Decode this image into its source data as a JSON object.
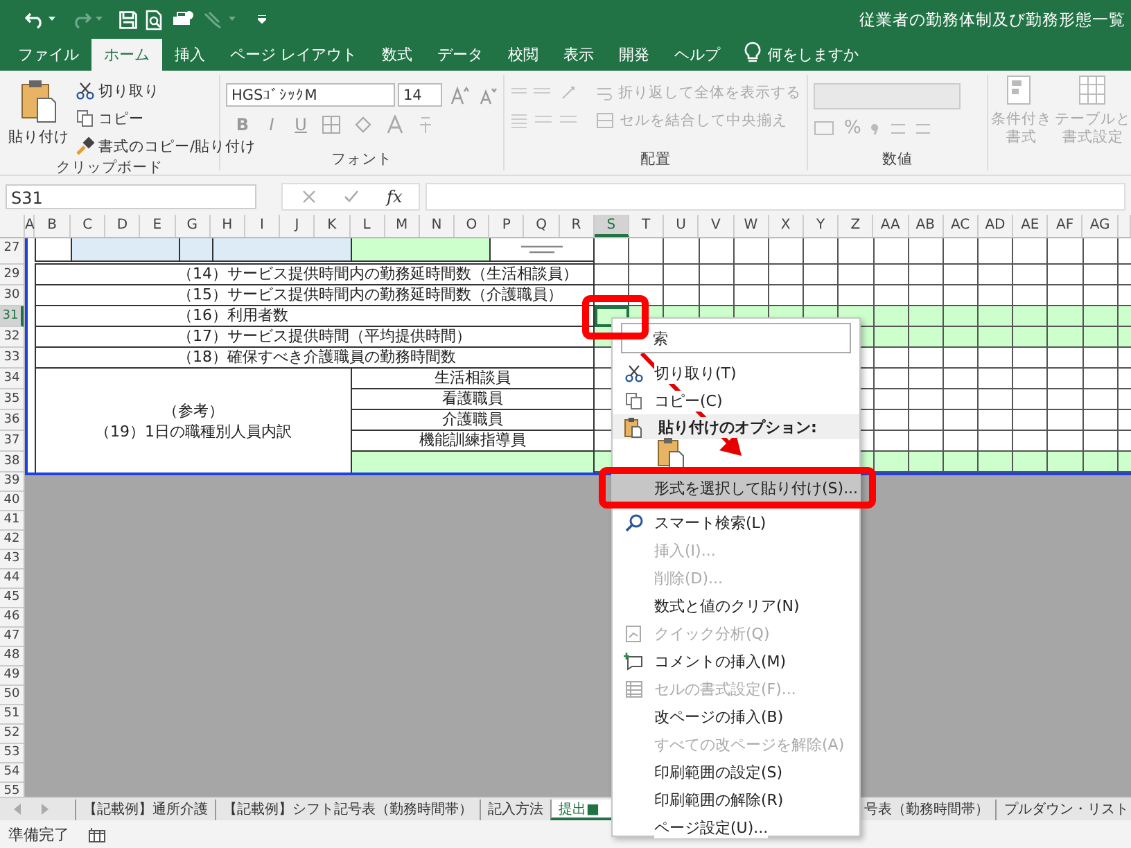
{
  "title_bar": {
    "title": "従業者の勤務体制及び勤務形態一覧"
  },
  "ribbon_tabs": [
    {
      "label": "ファイル",
      "selected": false
    },
    {
      "label": "ホーム",
      "selected": true
    },
    {
      "label": "挿入",
      "selected": false
    },
    {
      "label": "ページ レイアウト",
      "selected": false
    },
    {
      "label": "数式",
      "selected": false
    },
    {
      "label": "データ",
      "selected": false
    },
    {
      "label": "校閲",
      "selected": false
    },
    {
      "label": "表示",
      "selected": false
    },
    {
      "label": "開発",
      "selected": false
    },
    {
      "label": "ヘルプ",
      "selected": false
    }
  ],
  "tell_me": {
    "placeholder": "何をしますか"
  },
  "ribbon": {
    "clipboard": {
      "label": "クリップボード",
      "paste": "貼り付け",
      "cut": "切り取り",
      "copy": "コピー",
      "format_painter": "書式のコピー/貼り付け"
    },
    "font": {
      "label": "フォント",
      "font_name": "HGSｺﾞｼｯｸM",
      "font_size": "14",
      "bold": "B",
      "italic": "I",
      "underline": "U"
    },
    "alignment": {
      "label": "配置",
      "wrap_text": "折り返して全体を表示する",
      "merge_center": "セルを結合して中央揃え"
    },
    "number": {
      "label": "数値",
      "percent": "%"
    },
    "styles": {
      "conditional_formatting": [
        "条件付き",
        "書式"
      ],
      "format_as_table": [
        "テーブルと",
        "書式設定"
      ]
    }
  },
  "formula_bar": {
    "name_box": "S31",
    "function": "fx"
  },
  "sheet": {
    "columns": [
      {
        "label": "A",
        "selected": false
      },
      {
        "label": "B",
        "selected": false
      },
      {
        "label": "C",
        "selected": false
      },
      {
        "label": "D",
        "selected": false
      },
      {
        "label": "E",
        "selected": false
      },
      {
        "label": "G",
        "selected": false
      },
      {
        "label": "H",
        "selected": false
      },
      {
        "label": "I",
        "selected": false
      },
      {
        "label": "J",
        "selected": false
      },
      {
        "label": "K",
        "selected": false
      },
      {
        "label": "L",
        "selected": false
      },
      {
        "label": "M",
        "selected": false
      },
      {
        "label": "N",
        "selected": false
      },
      {
        "label": "O",
        "selected": false
      },
      {
        "label": "P",
        "selected": false
      },
      {
        "label": "Q",
        "selected": false
      },
      {
        "label": "R",
        "selected": false
      },
      {
        "label": "S",
        "selected": true
      },
      {
        "label": "T",
        "selected": false
      },
      {
        "label": "U",
        "selected": false
      },
      {
        "label": "V",
        "selected": false
      },
      {
        "label": "W",
        "selected": false
      },
      {
        "label": "X",
        "selected": false
      },
      {
        "label": "Y",
        "selected": false
      },
      {
        "label": "Z",
        "selected": false
      },
      {
        "label": "AA",
        "selected": false
      },
      {
        "label": "AB",
        "selected": false
      },
      {
        "label": "AC",
        "selected": false
      },
      {
        "label": "AD",
        "selected": false
      },
      {
        "label": "AE",
        "selected": false
      },
      {
        "label": "AF",
        "selected": false
      },
      {
        "label": "AG",
        "selected": false
      }
    ],
    "body_rows": [
      {
        "label": "27",
        "selected": false,
        "shaded": false
      },
      {
        "label": "29",
        "selected": false,
        "shaded": false
      },
      {
        "label": "30",
        "selected": false,
        "shaded": false
      },
      {
        "label": "31",
        "selected": true,
        "shaded": true
      },
      {
        "label": "32",
        "selected": false,
        "shaded": true
      },
      {
        "label": "33",
        "selected": false,
        "shaded": false
      },
      {
        "label": "34",
        "selected": false,
        "shaded": false
      },
      {
        "label": "35",
        "selected": false,
        "shaded": false
      },
      {
        "label": "36",
        "selected": false,
        "shaded": false
      },
      {
        "label": "37",
        "selected": false,
        "shaded": false
      },
      {
        "label": "38",
        "selected": false,
        "shaded": true
      }
    ],
    "empty_rows": [
      "39",
      "40",
      "41",
      "42",
      "43",
      "44",
      "45",
      "46",
      "47",
      "48",
      "49",
      "50",
      "51",
      "52",
      "53",
      "54",
      "55"
    ],
    "items": [
      "（14）サービス提供時間内の勤務延時間数（生活相談員）",
      "（15）サービス提供時間内の勤務延時間数（介護職員）",
      "（16）利用者数",
      "（17）サービス提供時間（平均提供時間）",
      "（18）確保すべき介護職員の勤務時間数"
    ],
    "reference": {
      "title": "（参考）",
      "subtitle": "（19）1日の職種別人員内訳",
      "roles": [
        "生活相談員",
        "看護職員",
        "介護職員",
        "機能訓練指導員"
      ]
    }
  },
  "context_menu": {
    "search": {
      "placeholder": "索"
    },
    "items": [
      {
        "kind": "cut",
        "label": "切り取り(T)",
        "disabled": false,
        "selected": false
      },
      {
        "kind": "copy",
        "label": "コピー(C)",
        "disabled": false,
        "selected": false
      },
      {
        "kind": "header",
        "label": "貼り付けのオプション:"
      },
      {
        "kind": "paste-options"
      },
      {
        "kind": "plain",
        "label": "形式を選択して貼り付け(S)...",
        "disabled": false,
        "selected": true
      },
      {
        "kind": "lookup",
        "label": "スマート検索(L)",
        "disabled": false,
        "selected": false
      },
      {
        "kind": "plain",
        "label": "挿入(I)...",
        "disabled": true,
        "selected": false
      },
      {
        "kind": "plain",
        "label": "削除(D)...",
        "disabled": true,
        "selected": false
      },
      {
        "kind": "plain",
        "label": "数式と値のクリア(N)",
        "disabled": false,
        "selected": false
      },
      {
        "kind": "analysis",
        "label": "クイック分析(Q)",
        "disabled": true,
        "selected": false
      },
      {
        "kind": "comment",
        "label": "コメントの挿入(M)",
        "disabled": false,
        "selected": false
      },
      {
        "kind": "format",
        "label": "セルの書式設定(F)...",
        "disabled": true,
        "selected": false
      },
      {
        "kind": "plain",
        "label": "改ページの挿入(B)",
        "disabled": false,
        "selected": false
      },
      {
        "kind": "plain",
        "label": "すべての改ページを解除(A)",
        "disabled": true,
        "selected": false
      },
      {
        "kind": "plain",
        "label": "印刷範囲の設定(S)",
        "disabled": false,
        "selected": false
      },
      {
        "kind": "plain",
        "label": "印刷範囲の解除(R)",
        "disabled": false,
        "selected": false
      },
      {
        "kind": "plain",
        "label": "ページ設定(U)...",
        "disabled": false,
        "selected": false
      }
    ]
  },
  "sheet_tabs": [
    {
      "label": "【記載例】通所介護",
      "selected": false
    },
    {
      "label": "【記載例】シフト記号表（勤務時間帯）",
      "selected": false
    },
    {
      "label": "記入方法",
      "selected": false
    },
    {
      "label": "提出■",
      "selected": true
    },
    {
      "label": "号表（勤務時間帯）",
      "selected": false
    },
    {
      "label": "プルダウン・リスト",
      "selected": false
    }
  ],
  "status_bar": {
    "status": "準備完了"
  }
}
